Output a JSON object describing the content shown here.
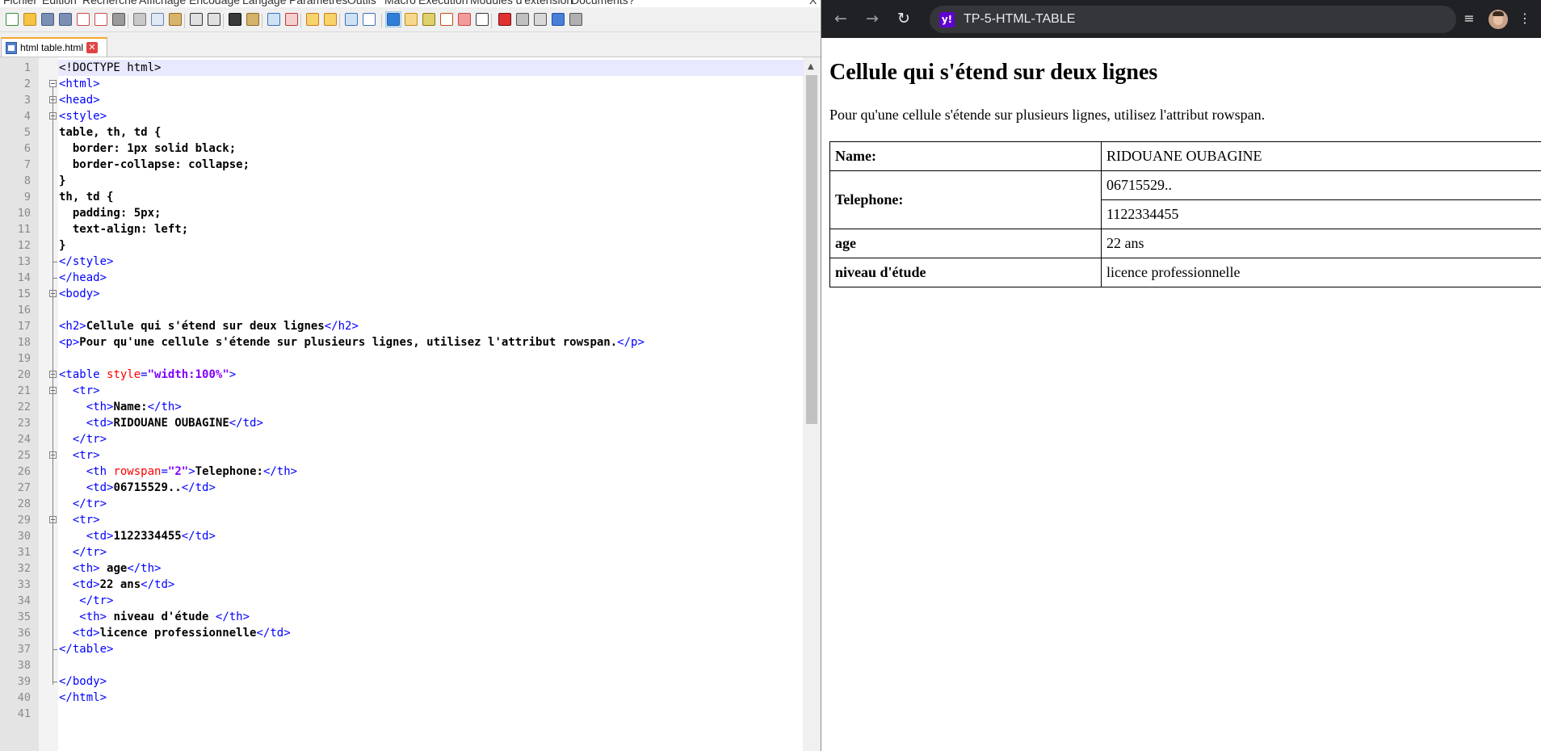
{
  "editor": {
    "menu": [
      "Fichier",
      "Édition",
      "Recherche",
      "Affichage",
      "Encodage",
      "Langage",
      "Paramètres",
      "Outils",
      "Macro",
      "Exécution",
      "Modules d'extension",
      "Documents",
      "?"
    ],
    "menu_close": "X",
    "tab": {
      "label": "html table.html",
      "close_glyph": "✕"
    },
    "lines": [
      "<!DOCTYPE html>",
      "<html>",
      "<head>",
      "<style>",
      "table, th, td {",
      "  border: 1px solid black;",
      "  border-collapse: collapse;",
      "}",
      "th, td {",
      "  padding: 5px;",
      "  text-align: left;",
      "}",
      "</style>",
      "</head>",
      "<body>",
      "",
      "<h2>Cellule qui s'étend sur deux lignes</h2>",
      "<p>Pour qu'une cellule s'étende sur plusieurs lignes, utilisez l'attribut rowspan.</p>",
      "",
      "<table style=\"width:100%\">",
      "  <tr>",
      "    <th>Name:</th>",
      "    <td>RIDOUANE OUBAGINE</td>",
      "  </tr>",
      "  <tr>",
      "    <th rowspan=\"2\">Telephone:</th>",
      "    <td>06715529..</td>",
      "  </tr>",
      "  <tr>",
      "    <td>1122334455</td>",
      "  </tr>",
      "  <th> age</th>",
      "  <td>22 ans</td>",
      "   </tr>",
      "   <th> niveau d'étude </th>",
      "  <td>licence professionnelle</td>",
      "</table>",
      "",
      "</body>",
      "</html>",
      ""
    ]
  },
  "browser": {
    "tab_title": "TP-5-HTML-TABLE",
    "favicon_letter": "y!",
    "icons": [
      "back-icon",
      "forward-icon",
      "reload-icon",
      "media-control-icon",
      "avatar",
      "menu-kebab-icon"
    ],
    "page": {
      "heading": "Cellule qui s'étend sur deux lignes",
      "paragraph": "Pour qu'une cellule s'étende sur plusieurs lignes, utilisez l'attribut rowspan.",
      "table": {
        "name_label": "Name:",
        "name_value": "RIDOUANE OUBAGINE",
        "phone_label": "Telephone:",
        "phone_1": "06715529..",
        "phone_2": "1122334455",
        "age_label": "age",
        "age_value": "22 ans",
        "level_label": "niveau d'étude",
        "level_value": "licence professionnelle"
      }
    }
  },
  "colors": {
    "tag": "#0000ff",
    "attr": "#ff0000",
    "attr_value": "#8000ff",
    "chrome_bg": "#202124",
    "omnibox_bg": "#35363a",
    "yahoo_purple": "#6001d2"
  }
}
